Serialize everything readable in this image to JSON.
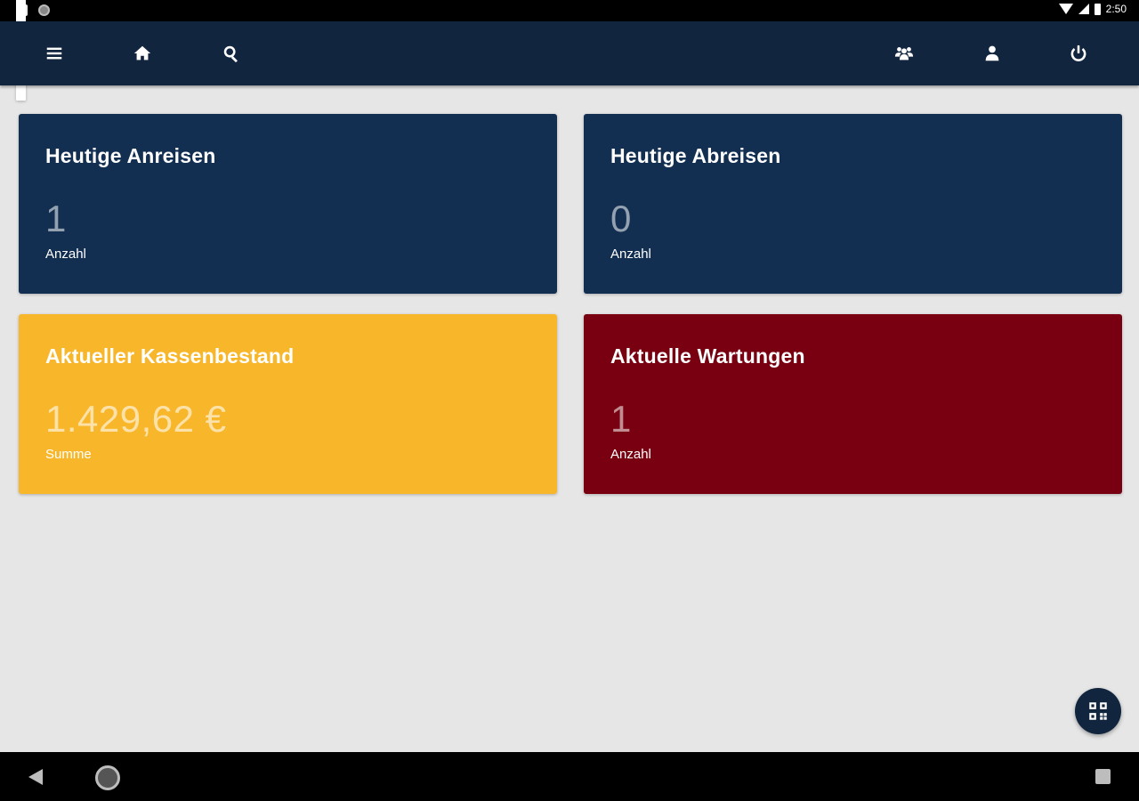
{
  "status_bar": {
    "time": "2:50",
    "left_icons": [
      "notification-icon",
      "sd-card-icon",
      "sync-icon"
    ],
    "right_icons": [
      "wifi-icon",
      "signal-icon",
      "battery-icon"
    ]
  },
  "app_bar": {
    "left_icons": [
      "menu-icon",
      "home-icon",
      "search-icon"
    ],
    "right_icons": [
      "group-icon",
      "user-icon",
      "power-icon"
    ]
  },
  "cards": [
    {
      "title": "Heutige Anreisen",
      "value": "1",
      "caption": "Anzahl",
      "color": "#122f52"
    },
    {
      "title": "Heutige Abreisen",
      "value": "0",
      "caption": "Anzahl",
      "color": "#122f52"
    },
    {
      "title": "Aktueller Kassenbestand",
      "value": "1.429,62 €",
      "caption": "Summe",
      "color": "#f8b72a"
    },
    {
      "title": "Aktuelle Wartungen",
      "value": "1",
      "caption": "Anzahl",
      "color": "#780010"
    }
  ],
  "fab": {
    "icon": "qr-code-icon"
  },
  "nav_bar": {
    "icons": [
      "back-icon",
      "home-circle-icon",
      "recents-icon"
    ]
  },
  "colors": {
    "app_bar": "#12253e",
    "background": "#e6e6e6"
  }
}
